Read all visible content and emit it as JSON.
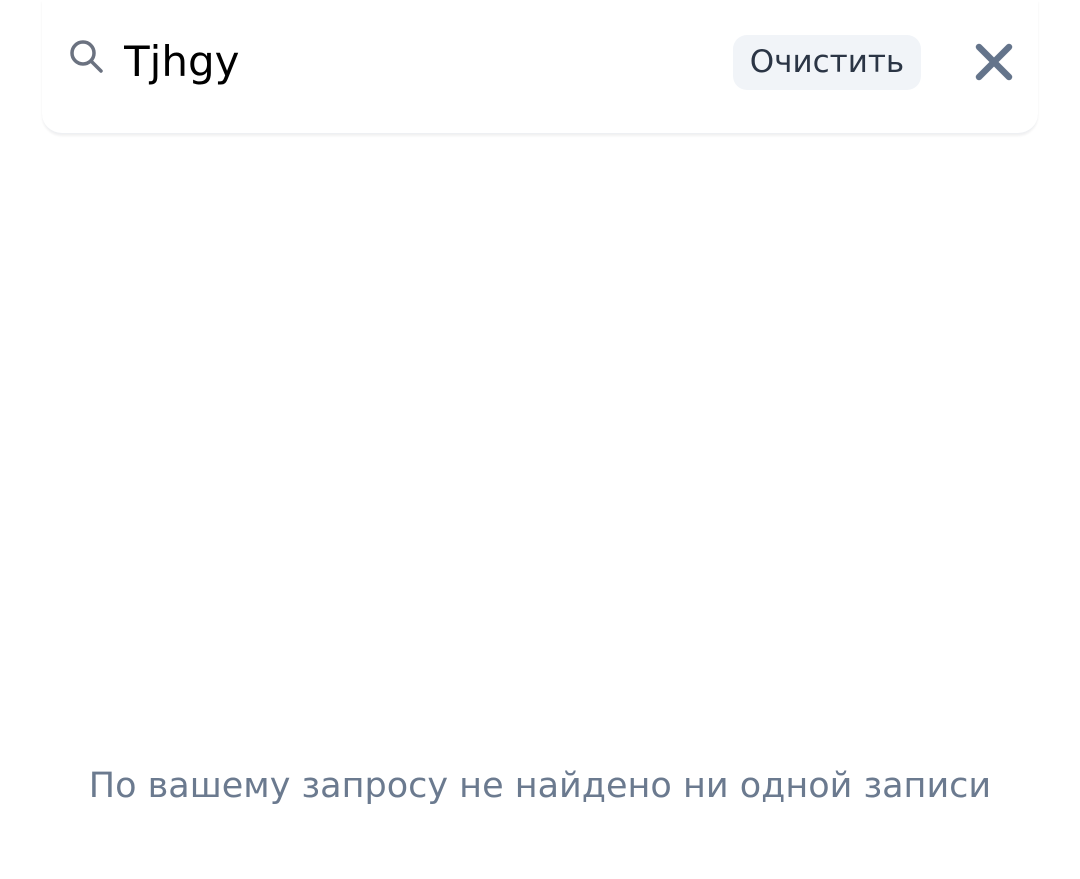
{
  "search": {
    "query": "Tjhgy",
    "clear_label": "Очистить",
    "search_icon": "search-icon",
    "close_icon": "close-icon"
  },
  "results": {
    "empty_message": "По вашему запросу не найдено ни одной записи"
  },
  "colors": {
    "icon_gray": "#6b7280",
    "close_icon": "#64748b",
    "clear_button_bg": "#f1f4f8",
    "empty_text": "#6b7a8f"
  }
}
